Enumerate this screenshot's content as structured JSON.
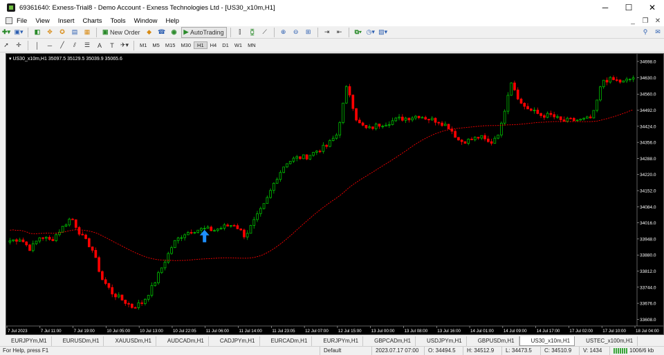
{
  "window": {
    "title": "69361640: Exness-Trial8 - Demo Account - Exness Technologies Ltd - [US30_x10m,H1]",
    "minimize": "─",
    "maximize": "☐",
    "close": "✕"
  },
  "menu": {
    "items": [
      "File",
      "View",
      "Insert",
      "Charts",
      "Tools",
      "Window",
      "Help"
    ],
    "mdi_min": "_",
    "mdi_restore": "❐",
    "mdi_close": "✕"
  },
  "toolbar": {
    "new_order": "New Order",
    "auto_trading": "AutoTrading",
    "timeframes": [
      "M1",
      "M5",
      "M15",
      "M30",
      "H1",
      "H4",
      "D1",
      "W1",
      "MN"
    ],
    "active_timeframe": "H1"
  },
  "chart": {
    "header": "▾ US30_x10m,H1  35097.5 35129.5 35039.9 35065.6",
    "symbol": "US30_x10m",
    "timeframe": "H1",
    "ohlc": {
      "open": 35097.5,
      "high": 35129.5,
      "low": 35039.9,
      "close": 35065.6
    },
    "background": "#000000",
    "bull_color": "#00c000",
    "bear_color": "#ff0000",
    "ma_color": "#ff0000",
    "arrow_color": "#1e90ff",
    "price_axis": [
      "34698.0",
      "34630.0",
      "34560.0",
      "34492.0",
      "34424.0",
      "34356.0",
      "34288.0",
      "34220.0",
      "34152.0",
      "34084.0",
      "34016.0",
      "33948.0",
      "33880.0",
      "33812.0",
      "33744.0",
      "33676.0",
      "33608.0"
    ],
    "time_axis": [
      "7 Jul 2023",
      "7 Jul 11:00",
      "7 Jul 19:00",
      "10 Jul 05:00",
      "10 Jul 13:00",
      "10 Jul 22:05",
      "11 Jul 06:00",
      "11 Jul 14:00",
      "11 Jul 23:05",
      "12 Jul 07:00",
      "12 Jul 15:00",
      "13 Jul 00:00",
      "13 Jul 08:00",
      "13 Jul 16:00",
      "14 Jul 01:00",
      "14 Jul 09:00",
      "14 Jul 17:00",
      "17 Jul 02:00",
      "17 Jul 10:00",
      "18 Jul 04:00"
    ]
  },
  "chart_data": {
    "type": "candlestick",
    "ylim": [
      33580,
      34730
    ],
    "close_path": [
      33940,
      33950,
      33905,
      33960,
      33940,
      33990,
      34040,
      33960,
      33910,
      33780,
      33720,
      33690,
      33660,
      33680,
      33750,
      33840,
      33930,
      33970,
      33985,
      33990,
      33985,
      34000,
      34010,
      33960,
      34030,
      34100,
      34200,
      34270,
      34290,
      34295,
      34320,
      34340,
      34390,
      34600,
      34440,
      34410,
      34430,
      34440,
      34455,
      34460,
      34470,
      34455,
      34445,
      34420,
      34360,
      34365,
      34380,
      34350,
      34410,
      34620,
      34520,
      34490,
      34470,
      34470,
      34445,
      34450,
      34450,
      34460,
      34620,
      34620,
      34610,
      34630
    ]
  },
  "tabs": {
    "items": [
      "EURJPYm,M1",
      "EURUSDm,H1",
      "XAUUSDm,H1",
      "AUDCADm,H1",
      "CADJPYm,H1",
      "EURCADm,H1",
      "EURJPYm,H1",
      "GBPCADm,H1",
      "USDJPYm,H1",
      "GBPUSDm,H1",
      "US30_x10m,H1",
      "USTEC_x100m,H1"
    ],
    "active": "US30_x10m,H1"
  },
  "status": {
    "help": "For Help, press F1",
    "profile": "Default",
    "datetime": "2023.07.17 07:00",
    "open": "O: 34494.5",
    "high": "H: 34512.9",
    "low": "L: 34473.5",
    "close": "C: 34510.9",
    "volume": "V: 1434",
    "traffic": "1006/6 kb"
  }
}
